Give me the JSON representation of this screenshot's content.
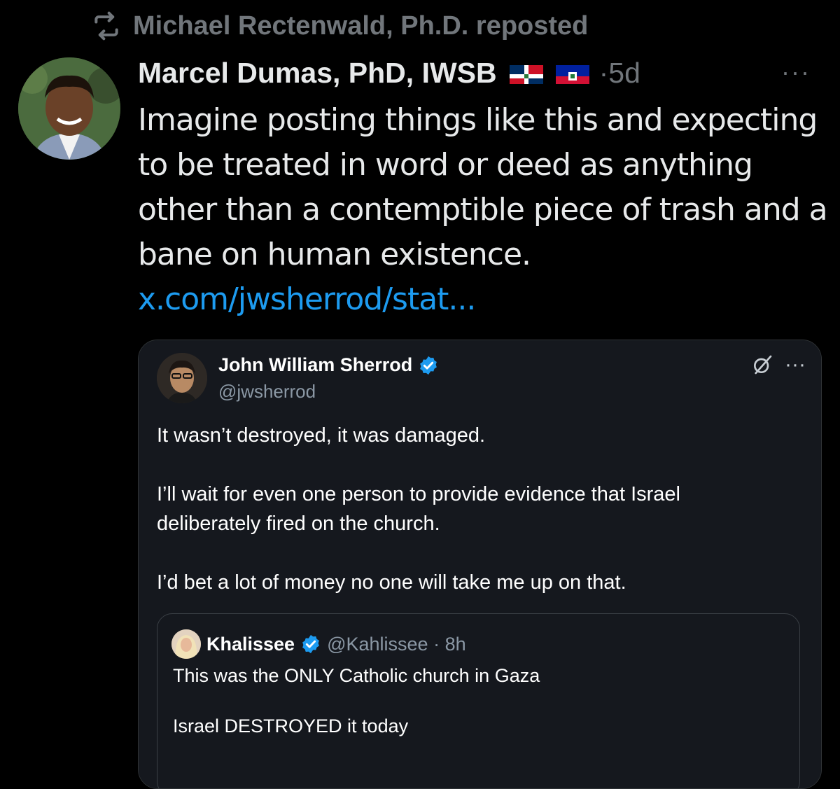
{
  "repost": {
    "label": "Michael Rectenwald, Ph.D. reposted",
    "icon": "repost-icon"
  },
  "post": {
    "author_name": "Marcel Dumas, PhD, IWSB",
    "flags": [
      "dominican-republic-flag",
      "haiti-flag"
    ],
    "time": "5d",
    "dot": "·",
    "more": "···",
    "text": "Imagine posting things like this and expecting to be treated in word or deed as anything other than a contemptible piece of trash and a bane on human existence.",
    "link": "x.com/jwsherrod/stat..."
  },
  "quote": {
    "name": "John William Sherrod",
    "handle": "@jwsherrod",
    "more": "···",
    "paragraphs": [
      "It wasn’t destroyed, it was damaged.",
      "I’ll wait for even one person to provide evidence that Israel deliberately fired on the church.",
      "I’d bet a lot of money no one will take me up on that."
    ]
  },
  "inner_quote": {
    "name": "Khalissee",
    "handle": "@Kahlissee",
    "dot": "·",
    "time": "8h",
    "paragraphs": [
      "This was the ONLY Catholic church in Gaza",
      "Israel DESTROYED it today"
    ]
  },
  "colors": {
    "background": "#000000",
    "text": "#e7e9ea",
    "muted": "#71767b",
    "link": "#1d9bf0",
    "verified": "#1d9bf0"
  }
}
